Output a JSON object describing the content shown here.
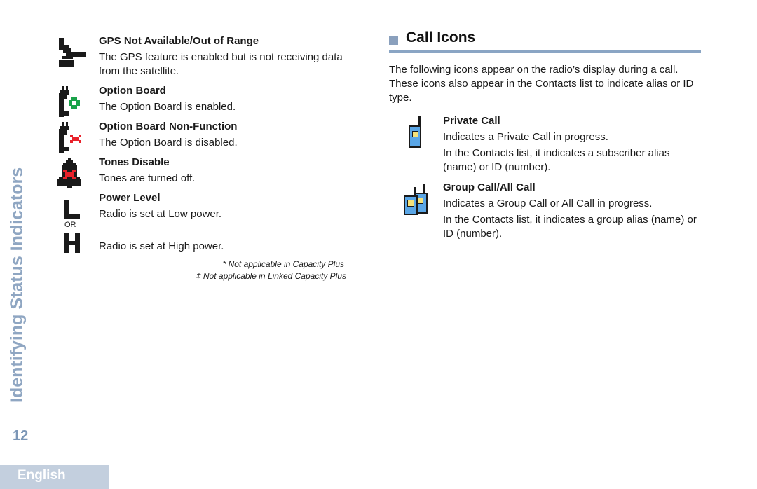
{
  "sidebar": {
    "section_title": "Identifying Status Indicators",
    "page_number": "12",
    "language_tab": "English"
  },
  "left_column": {
    "items": [
      {
        "icon": "gps-not-available-icon",
        "title": "GPS Not Available/Out of Range",
        "description": "The GPS feature is enabled but is not receiving data from the satellite."
      },
      {
        "icon": "option-board-icon",
        "title": "Option Board",
        "description": "The Option Board is enabled."
      },
      {
        "icon": "option-board-non-function-icon",
        "title": "Option Board Non-Function",
        "description": "The Option Board is disabled."
      },
      {
        "icon": "tones-disable-icon",
        "title": "Tones Disable",
        "description": "Tones are turned off."
      },
      {
        "icon": "power-level-icon",
        "title": "Power Level",
        "description_low": "Radio is set at Low power.",
        "or_label": "OR",
        "description_high": "Radio is set at High power."
      }
    ],
    "footnotes": [
      "* Not applicable in Capacity Plus",
      "‡ Not applicable in Linked Capacity Plus"
    ]
  },
  "right_column": {
    "section_title": "Call Icons",
    "intro": "The following icons appear on the radio’s display during a call. These icons also appear in the Contacts list to indicate alias or ID type.",
    "items": [
      {
        "icon": "private-call-icon",
        "title": "Private Call",
        "description": "Indicates a Private Call in progress.",
        "note": "In the Contacts list, it indicates a subscriber alias (name) or ID (number)."
      },
      {
        "icon": "group-call-icon",
        "title": "Group Call/All Call",
        "description": "Indicates a Group Call or All Call in progress.",
        "note": "In the Contacts list, it indicates a group alias (name) or ID (number)."
      }
    ]
  },
  "colors": {
    "accent": "#8aa5c4",
    "sidebar_text": "#8fa6c2",
    "option_green": "#1aa34a",
    "disabled_red": "#e8222b",
    "radio_blue": "#5aa6e6",
    "radio_screen": "#f5e27a"
  }
}
